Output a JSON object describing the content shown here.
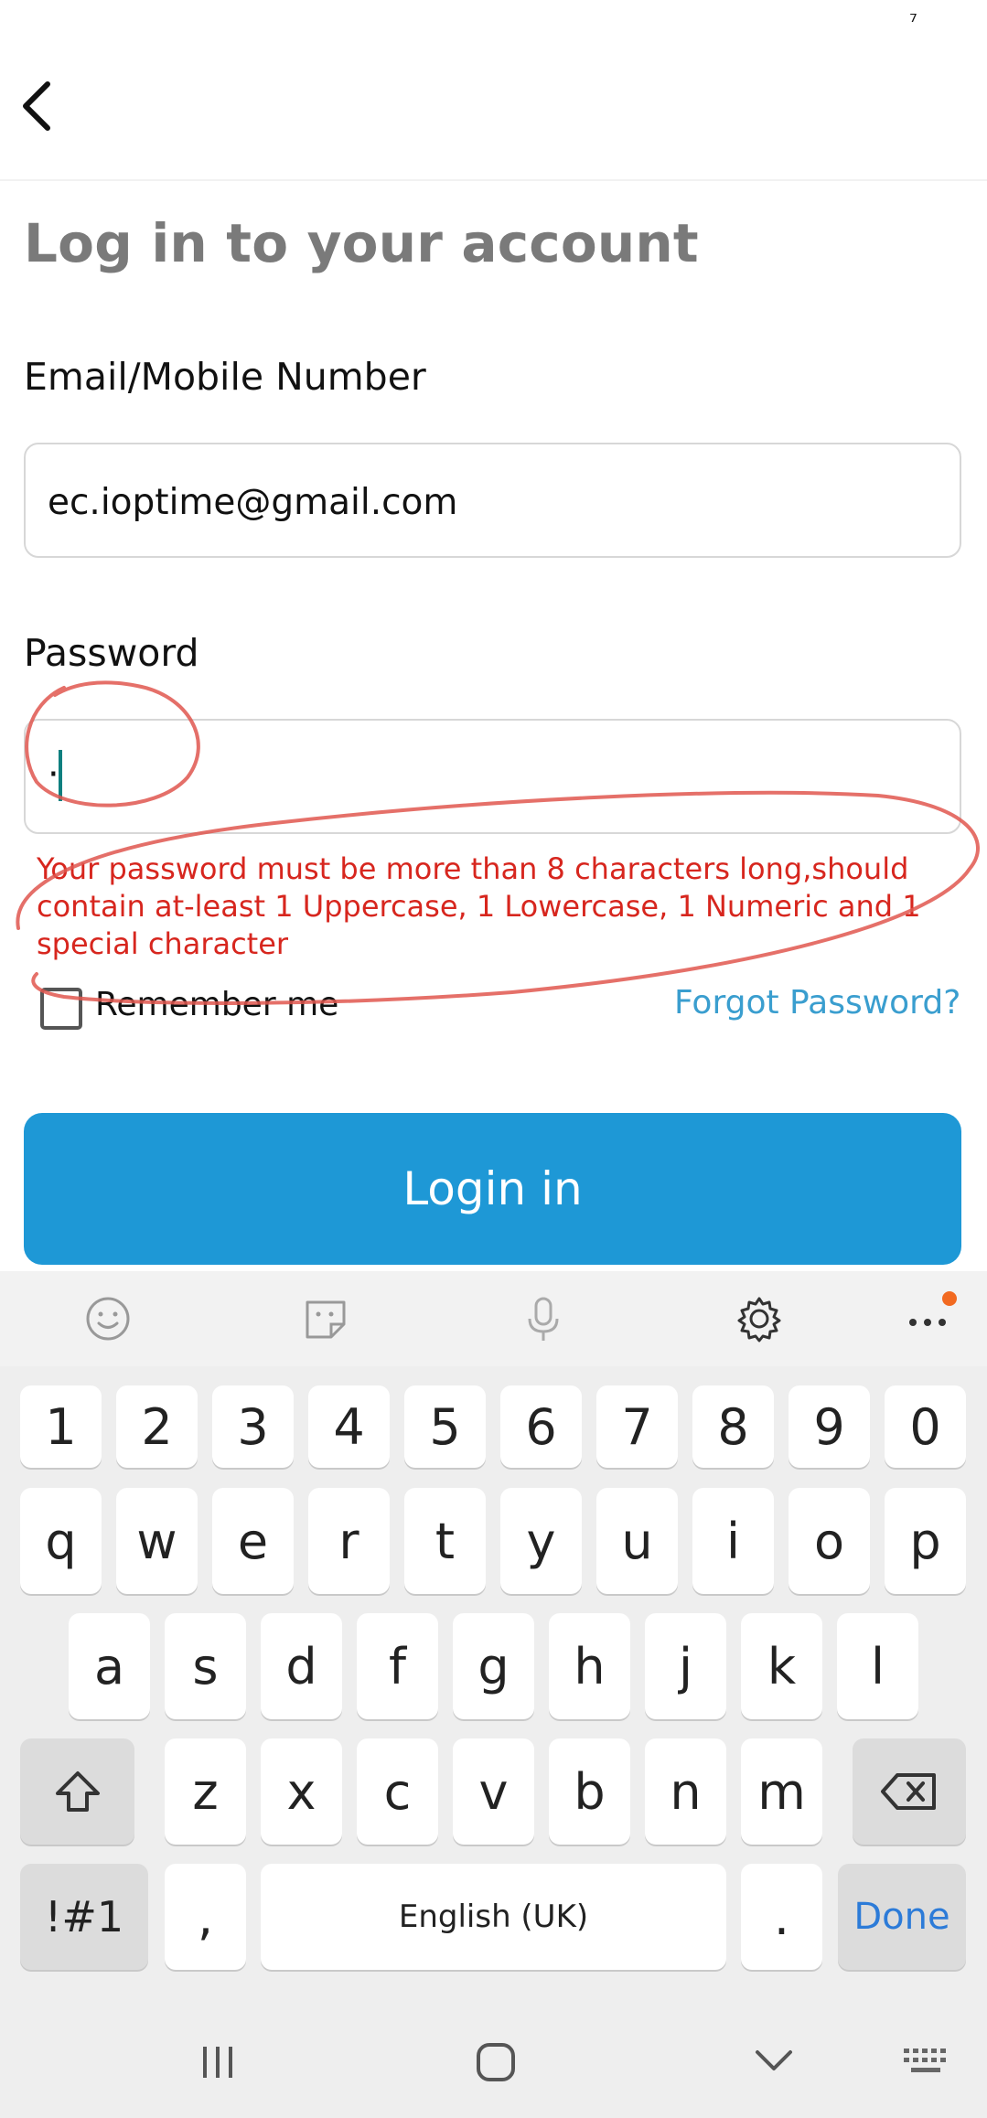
{
  "status": {
    "mark": "⁷"
  },
  "header": {
    "back_icon": "chevron-left-icon"
  },
  "page": {
    "title": "Log in to your account"
  },
  "form": {
    "email_label": "Email/Mobile Number",
    "email_value": "ec.ioptime@gmail.com",
    "password_label": "Password",
    "password_value": "·",
    "error": "Your password must be more than 8 characters long,should contain at-least 1 Uppercase, 1 Lowercase, 1 Numeric and 1 special character",
    "remember_label": "Remember me",
    "remember_checked": false,
    "forgot_label": "Forgot Password?",
    "login_label": "Login in"
  },
  "keyboard": {
    "toolbar_icons": [
      "emoji-icon",
      "sticker-icon",
      "microphone-icon",
      "settings-icon",
      "more-icon"
    ],
    "row_numbers": [
      "1",
      "2",
      "3",
      "4",
      "5",
      "6",
      "7",
      "8",
      "9",
      "0"
    ],
    "row_q": [
      "q",
      "w",
      "e",
      "r",
      "t",
      "y",
      "u",
      "i",
      "o",
      "p"
    ],
    "row_a": [
      "a",
      "s",
      "d",
      "f",
      "g",
      "h",
      "j",
      "k",
      "l"
    ],
    "row_z": [
      "z",
      "x",
      "c",
      "v",
      "b",
      "n",
      "m"
    ],
    "symbols_label": "!#1",
    "comma_label": ",",
    "space_label": "English (UK)",
    "period_label": ".",
    "done_label": "Done"
  },
  "colors": {
    "accent": "#1e98d6",
    "error": "#d7261e",
    "link": "#3a9ecf",
    "title": "#7a7a7a"
  }
}
